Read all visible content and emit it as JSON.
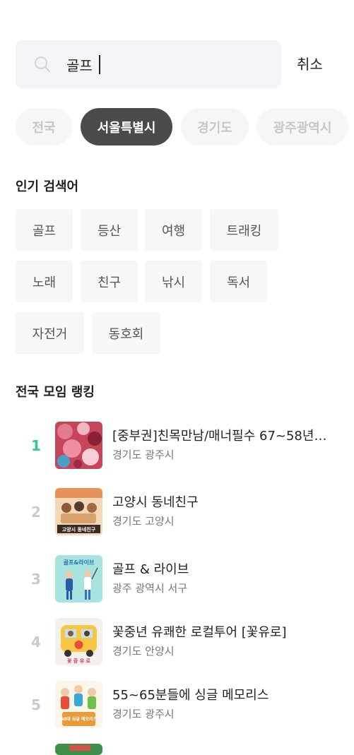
{
  "search": {
    "value": "골프",
    "cancel_label": "취소"
  },
  "regions": [
    {
      "label": "전국",
      "active": false
    },
    {
      "label": "서울특별시",
      "active": true
    },
    {
      "label": "경기도",
      "active": false
    },
    {
      "label": "광주광역시",
      "active": false
    }
  ],
  "popular": {
    "title": "인기 검색어",
    "keywords": [
      "골프",
      "등산",
      "여행",
      "트래킹",
      "노래",
      "친구",
      "낚시",
      "독서",
      "자전거",
      "동호회"
    ]
  },
  "ranking": {
    "title": "전국 모임 랭킹",
    "items": [
      {
        "rank": "1",
        "title": "[중부권]친목만남/매너필수 67~58년생...",
        "location": "경기도 광주시"
      },
      {
        "rank": "2",
        "title": "고양시 동네친구",
        "location": "경기도 고양시",
        "thumb_text": "고양시 동네친구"
      },
      {
        "rank": "3",
        "title": "골프 & 라이브",
        "location": "광주 광역시 서구",
        "thumb_text": "골프&라이브"
      },
      {
        "rank": "4",
        "title": "꽃중년 유쾌한 로컬투어 [꽃유로]",
        "location": "경기도 안양시",
        "thumb_text": "꽃 중 유 로"
      },
      {
        "rank": "5",
        "title": "55~65분들에 싱글 메모리스",
        "location": "경기도 광주시",
        "thumb_text": "60대 싱글 메모리스"
      }
    ]
  },
  "colors": {
    "accent_rank": "#2ec98e",
    "active_chip": "#4b4b4b"
  }
}
